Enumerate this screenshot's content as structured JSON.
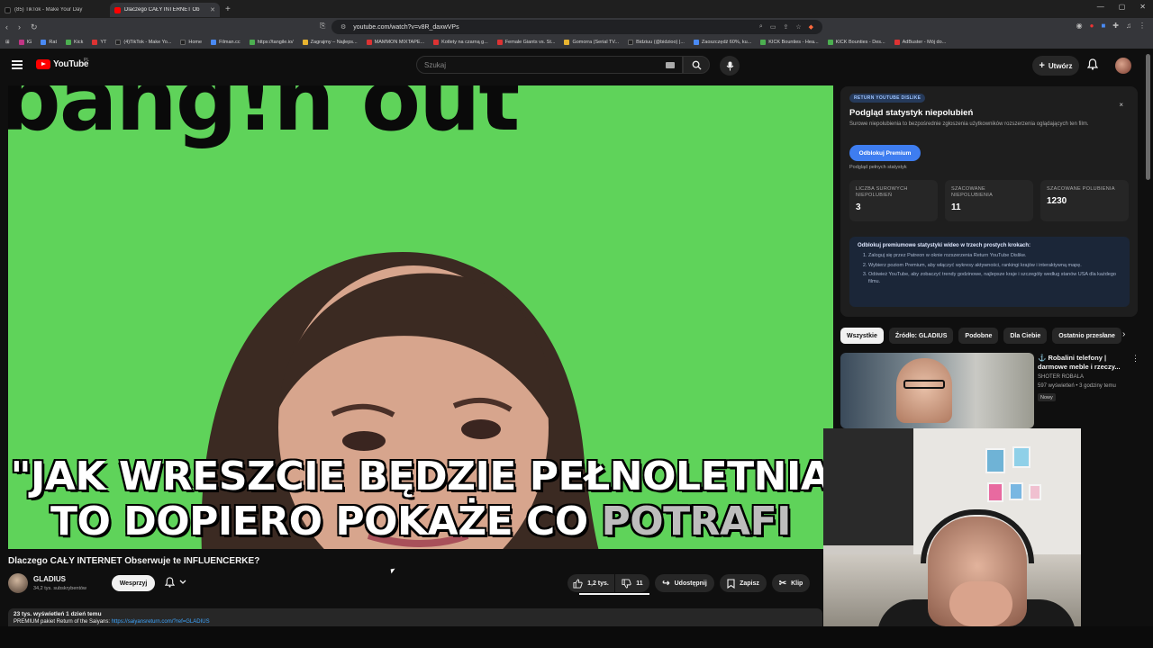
{
  "browser": {
    "tabs": [
      {
        "title": "(85) TikTok - Make Your Day"
      },
      {
        "title": "Dlaczego CAŁY INTERNET Ob"
      }
    ],
    "url": "youtube.com/watch?v=v8R_daxwVPs",
    "bookmarks": [
      "IG",
      "Rat",
      "Kick",
      "YT",
      "(4)TikTok - Make Yo...",
      "Home",
      "Filman.cc",
      "https://tangile.io/",
      "Zagrajmy – Najleps...",
      "MAMMON MIXTAPE...",
      "Kotlety na czarną g...",
      "Female Giants vs. St...",
      "Gomorra (Serial TV...",
      "Bidziuu (@bidzioo) |...",
      "Zaoszczędź 60%, ku...",
      "KICK Bounties - Hea...",
      "KICK Bounties - Des...",
      "AdBuster - Mój do..."
    ]
  },
  "masthead": {
    "logo_text": "YouTube",
    "region": "PL",
    "search_placeholder": "Szukaj",
    "create_label": "Utwórz"
  },
  "video": {
    "caption_line1": "\"JAK WRESZCIE BĘDZIE PEŁNOLETNIA",
    "caption_line2_bright": "TO DOPIERO POKAŻE CO ",
    "caption_line2_dim": "POTRAFI",
    "title": "Dlaczego CAŁY INTERNET Obserwuje te INFLUENCERKE?"
  },
  "channel": {
    "name": "GLADIUS",
    "subscribers": "34,2 tys. subskrybentów",
    "support_label": "Wesprzyj"
  },
  "actions": {
    "likes": "1,2 tys.",
    "dislikes": "11",
    "share": "Udostępnij",
    "save": "Zapisz",
    "clip": "Klip"
  },
  "description": {
    "stats": "23 tys. wyświetleń  1 dzień temu",
    "line_text": "PREMIUM pakiet Return of the Saiyans: ",
    "line_link": "https://saiyansreturn.com/?ref=GLADIUS"
  },
  "ryd": {
    "badge": "RETURN YOUTUBE DISLIKE",
    "close": "×",
    "title": "Podgląd statystyk niepolubień",
    "subtitle": "Surowe niepolubienia to bezpośrednie zgłoszenia użytkowników rozszerzenia oglądających ten film.",
    "unlock_label": "Odblokuj Premium",
    "full_stats": "Podgląd pełnych statystyk",
    "stats": [
      {
        "label": "LICZBA SUROWYCH NIEPOLUBIEŃ",
        "value": "3"
      },
      {
        "label": "SZACOWANE NIEPOLUBIENIA",
        "value": "11"
      },
      {
        "label": "SZACOWANE POLUBIENIA",
        "value": "1230"
      }
    ],
    "steps_title": "Odblokuj premiumowe statystyki wideo w trzech prostych krokach:",
    "steps": [
      "Zaloguj się przez Patreon w oknie rozszerzenia Return YouTube Dislike.",
      "Wybierz poziom Premium, aby włączyć wykresy aktywności, rankingi krajów i interaktywną mapę.",
      "Odśwież YouTube, aby zobaczyć trendy godzinowe, najlepsze kraje i szczegóły według stanów USA dla każdego filmu."
    ]
  },
  "chips": [
    "Wszystkie",
    "Źródło: GLADIUS",
    "Podobne",
    "Dla Ciebie",
    "Ostatnio przesłane"
  ],
  "recommended": {
    "title": "Robalini telefony | darmowe meble i rzeczy...",
    "channel": "SHOTER ROBALA",
    "meta": "597 wyświetleń • 3 godziny temu",
    "badge": "Nowy"
  },
  "colors": {
    "brand_red": "#ff0000",
    "link_blue": "#3ea6ff",
    "ryd_button": "#3e7df0",
    "greenscreen": "#5fd35a"
  }
}
